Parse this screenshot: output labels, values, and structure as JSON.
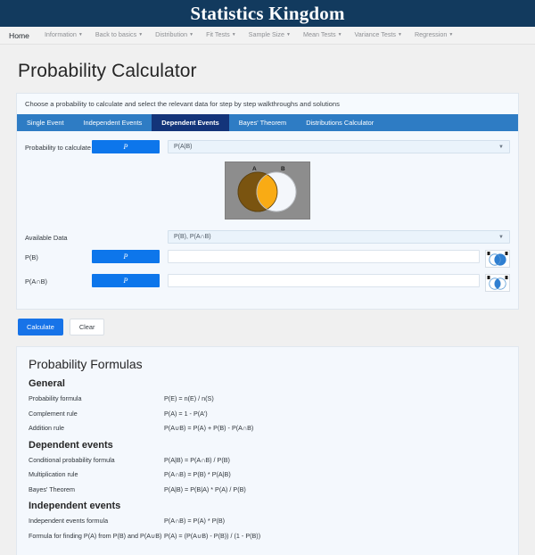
{
  "masthead": {
    "title": "Statistics Kingdom"
  },
  "nav": {
    "items": [
      {
        "label": "Home",
        "has_caret": false
      },
      {
        "label": "Information",
        "has_caret": true
      },
      {
        "label": "Back to basics",
        "has_caret": true
      },
      {
        "label": "Distribution",
        "has_caret": true
      },
      {
        "label": "Fit Tests",
        "has_caret": true
      },
      {
        "label": "Sample Size",
        "has_caret": true
      },
      {
        "label": "Mean Tests",
        "has_caret": true
      },
      {
        "label": "Variance Tests",
        "has_caret": true
      },
      {
        "label": "Regression",
        "has_caret": true
      }
    ]
  },
  "page": {
    "title": "Probability Calculator",
    "intro": "Choose a probability to calculate and select the relevant data for step by step walkthroughs and solutions"
  },
  "tabs": [
    {
      "label": "Single Event",
      "active": false
    },
    {
      "label": "Independent Events",
      "active": false
    },
    {
      "label": "Dependent Events",
      "active": true
    },
    {
      "label": "Bayes' Theorem",
      "active": false
    },
    {
      "label": "Distributions Calculator",
      "active": false
    }
  ],
  "form": {
    "prob_to_calculate": {
      "label": "Probability to calculate",
      "button_glyph": "P",
      "select_value": "P(A|B)"
    },
    "venn": {
      "label_a": "A",
      "label_b": "B",
      "bg_color": "#8d8d8d",
      "circle_a_color": "#7a5410",
      "circle_b_color": "#f4f7fb",
      "intersection_color": "#f9ab14"
    },
    "available_data": {
      "label": "Available Data",
      "select_value": "P(B), P(A∩B)"
    },
    "inputs": [
      {
        "label": "P(B)",
        "button_glyph": "P",
        "value": "",
        "placeholder": "",
        "thumb": "venn-b-filled-icon"
      },
      {
        "label": "P(A∩B)",
        "button_glyph": "P",
        "value": "",
        "placeholder": "",
        "thumb": "venn-intersection-filled-icon"
      }
    ]
  },
  "actions": {
    "calculate_label": "Calculate",
    "clear_label": "Clear"
  },
  "formulas": {
    "title": "Probability Formulas",
    "sections": [
      {
        "heading": "General",
        "rows": [
          {
            "name": "Probability formula",
            "expr": "P(E) = n(E) / n(S)"
          },
          {
            "name": "Complement rule",
            "expr": "P(A) = 1 - P(A')"
          },
          {
            "name": "Addition rule",
            "expr": "P(A∪B) = P(A) + P(B) - P(A∩B)"
          }
        ]
      },
      {
        "heading": "Dependent events",
        "rows": [
          {
            "name": "Conditional probability formula",
            "expr": "P(A|B) = P(A∩B) / P(B)"
          },
          {
            "name": "Multiplication rule",
            "expr": "P(A∩B) = P(B) * P(A|B)"
          },
          {
            "name": "Bayes' Theorem",
            "expr": "P(A|B) = P(B|A) * P(A) / P(B)"
          }
        ]
      },
      {
        "heading": "Independent events",
        "rows": [
          {
            "name": "Independent events formula",
            "expr": "P(A∩B) = P(A) * P(B)"
          },
          {
            "name": "Formula for finding P(A) from P(B) and P(A∪B)",
            "expr": "P(A) = (P(A∪B) - P(B)) / (1 - P(B))"
          }
        ]
      }
    ]
  },
  "colors": {
    "masthead_bg": "#123a5e",
    "tab_bar": "#2e7cc4",
    "tab_active": "#13347a",
    "accent_button": "#0d76eb",
    "calculate_button": "#1773e8"
  }
}
